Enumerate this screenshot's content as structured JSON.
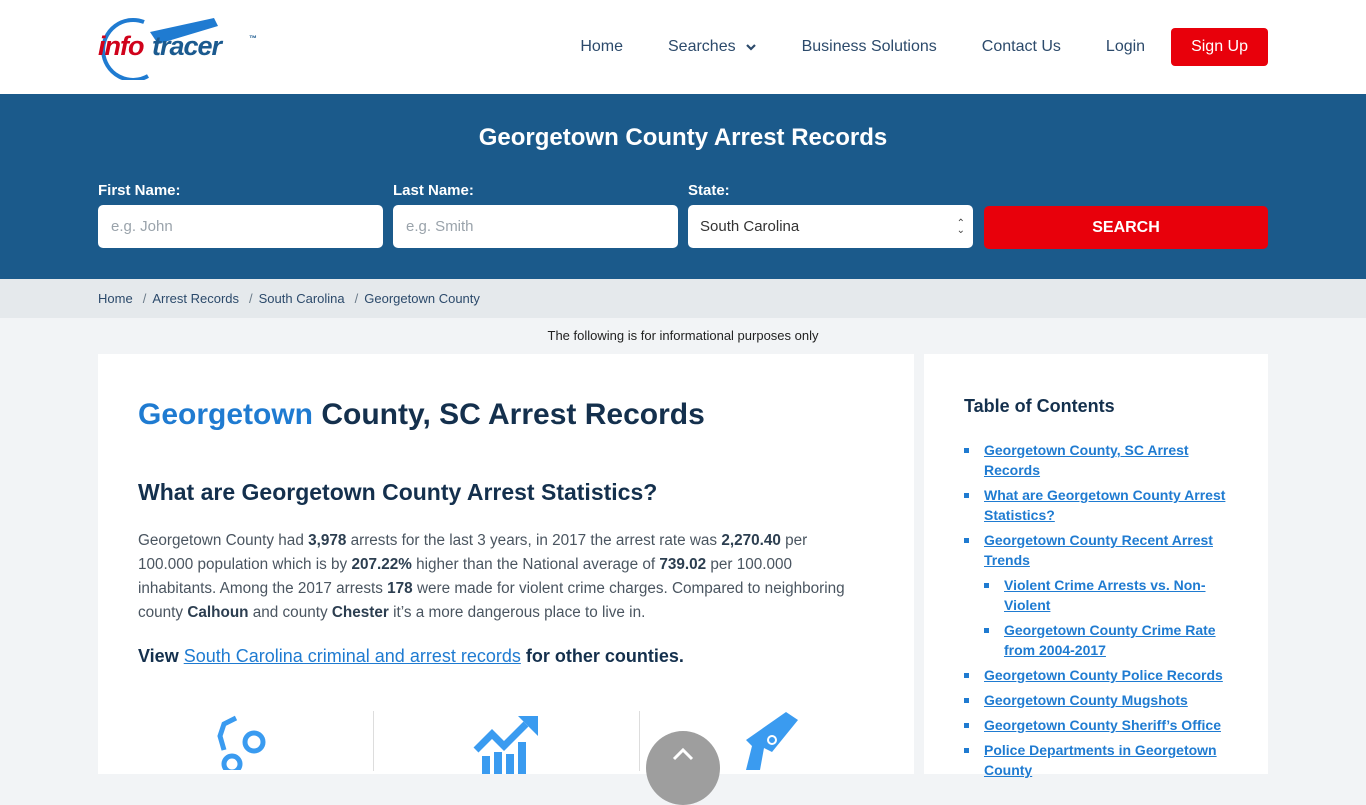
{
  "brand": {
    "part1": "info",
    "part2": "tracer",
    "tm": "™"
  },
  "nav": {
    "items": [
      {
        "label": "Home"
      },
      {
        "label": "Searches"
      },
      {
        "label": "Business Solutions"
      },
      {
        "label": "Contact Us"
      },
      {
        "label": "Login"
      }
    ],
    "signup": "Sign Up"
  },
  "search": {
    "title": "Georgetown County Arrest Records",
    "first_name_label": "First Name:",
    "first_name_placeholder": "e.g. John",
    "last_name_label": "Last Name:",
    "last_name_placeholder": "e.g. Smith",
    "state_label": "State:",
    "state_value": "South Carolina",
    "button": "SEARCH"
  },
  "breadcrumb": [
    "Home",
    "Arrest Records",
    "South Carolina",
    "Georgetown County"
  ],
  "info_note": "The following is for informational purposes only",
  "main": {
    "title_highlight": "Georgetown",
    "title_rest": " County, SC Arrest Records",
    "subtitle": "What are Georgetown County Arrest Statistics?",
    "para": {
      "t1": "Georgetown County had ",
      "arrests": "3,978",
      "t2": " arrests for the last 3 years, in 2017 the arrest rate was ",
      "rate": "2,270.40",
      "t3": " per 100.000 population which is by ",
      "pct": "207.22%",
      "t4": " higher than the National average of ",
      "national": "739.02",
      "t5": " per 100.000 inhabitants. Among the 2017 arrests ",
      "violent": "178",
      "t6": " were made for violent crime charges. Compared to neighboring county ",
      "county1": "Calhoun",
      "t7": " and county ",
      "county2": "Chester",
      "t8": " it’s a more dangerous place to live in."
    },
    "view_prefix": "View ",
    "view_link": "South Carolina criminal and arrest records",
    "view_suffix": " for other counties."
  },
  "toc": {
    "title": "Table of Contents",
    "items": [
      {
        "label": "Georgetown County, SC Arrest Records",
        "level": 1
      },
      {
        "label": "What are Georgetown County Arrest Statistics?",
        "level": 1
      },
      {
        "label": "Georgetown County Recent Arrest Trends",
        "level": 1
      },
      {
        "label": "Violent Crime Arrests vs. Non-Violent",
        "level": 2
      },
      {
        "label": "Georgetown County Crime Rate from 2004-2017",
        "level": 2
      },
      {
        "label": "Georgetown County Police Records",
        "level": 1
      },
      {
        "label": "Georgetown County Mugshots",
        "level": 1
      },
      {
        "label": "Georgetown County Sheriff’s Office",
        "level": 1
      },
      {
        "label": "Police Departments in Georgetown County",
        "level": 1
      }
    ]
  },
  "colors": {
    "brand_red": "#e8000b",
    "banner_blue": "#1b5a8b",
    "link_blue": "#1f7bd1",
    "icon_blue": "#3a9bf0"
  }
}
